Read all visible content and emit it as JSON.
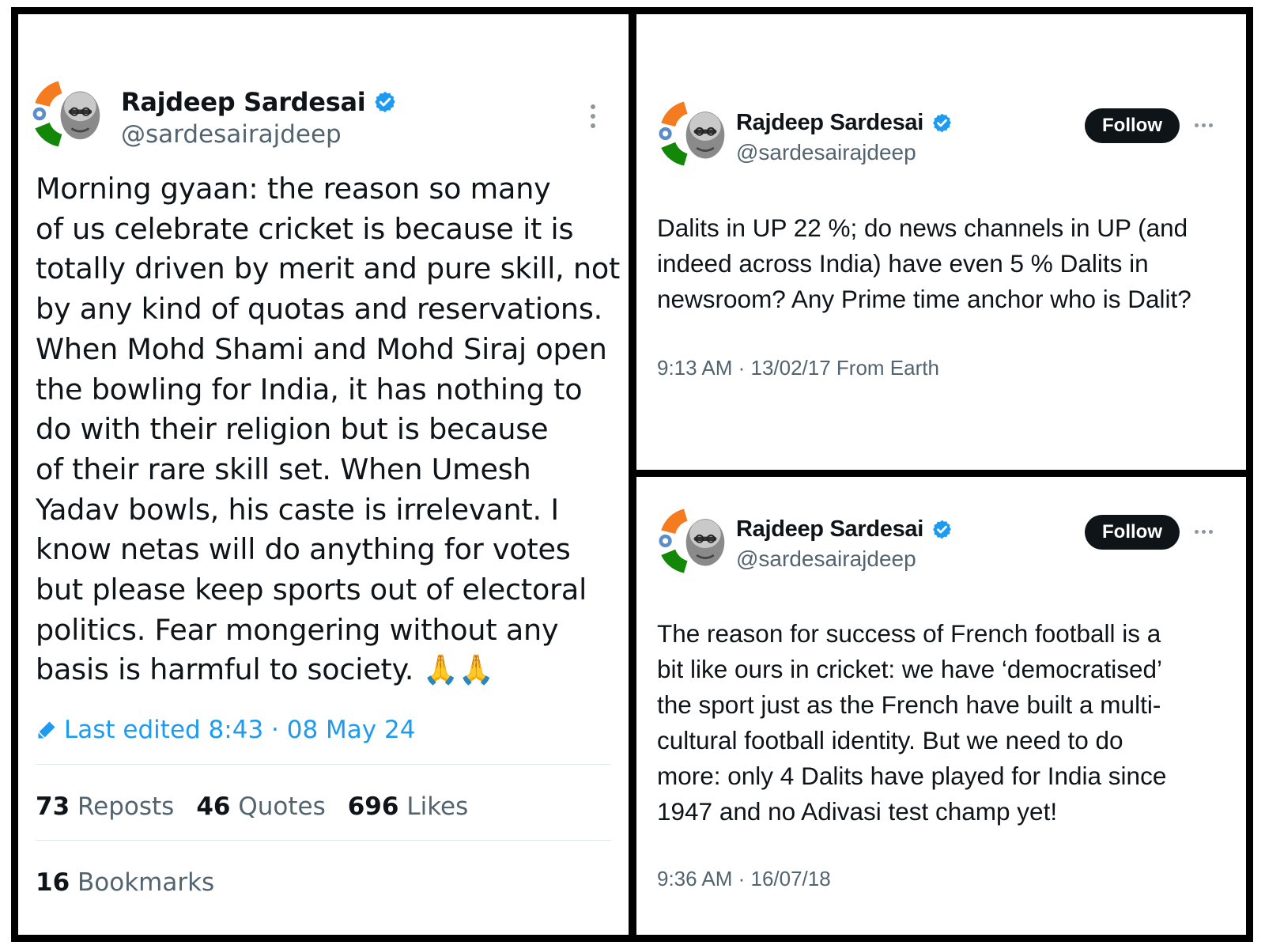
{
  "tweets": {
    "left": {
      "author_name": "Rajdeep Sardesai",
      "handle": "@sardesairajdeep",
      "text": "Morning gyaan: the reason so many\nof us celebrate cricket is because it is\ntotally driven by merit and pure skill, not\nby any kind of quotas and reservations.\nWhen Mohd Shami and Mohd Siraj open\nthe bowling for India, it has nothing to\ndo with their religion but is because\nof their rare skill set. When Umesh\nYadav bowls, his caste is irrelevant. I\nknow netas will do anything for votes\nbut please keep sports out of electoral\npolitics. Fear mongering without any\nbasis is harmful to society. 🙏🙏",
      "edited": "Last edited 8:43 · 08 May 24",
      "stats": [
        {
          "count": "73",
          "label": "Reposts"
        },
        {
          "count": "46",
          "label": "Quotes"
        },
        {
          "count": "696",
          "label": "Likes"
        }
      ],
      "bookmarks": {
        "count": "16",
        "label": "Bookmarks"
      }
    },
    "top_right": {
      "author_name": "Rajdeep Sardesai",
      "handle": "@sardesairajdeep",
      "follow_label": "Follow",
      "text": "Dalits in UP 22 %; do news channels in UP (and\nindeed across India) have even 5 % Dalits in\nnewsroom? Any Prime time anchor who is Dalit?",
      "meta": "9:13 AM · 13/02/17 From Earth"
    },
    "bottom_right": {
      "author_name": "Rajdeep Sardesai",
      "handle": "@sardesairajdeep",
      "follow_label": "Follow",
      "text": "The reason for success of French football is a\nbit like ours in cricket: we have ‘democratised’\nthe sport just as the French have built a multi-\ncultural football identity. But we need to do\nmore: only 4 Dalits have played for India since\n1947 and no Adivasi test champ yet!",
      "meta": "9:36 AM · 16/07/18"
    }
  },
  "colors": {
    "verified": "#1d9bf0",
    "link": "#1d9bf0",
    "secondary_text": "#536471",
    "follow_bg": "#0f1419",
    "frame": "#000000"
  },
  "icons": {
    "verified": "verified-badge-icon",
    "edit": "pencil-icon",
    "more": "more-options-icon"
  }
}
